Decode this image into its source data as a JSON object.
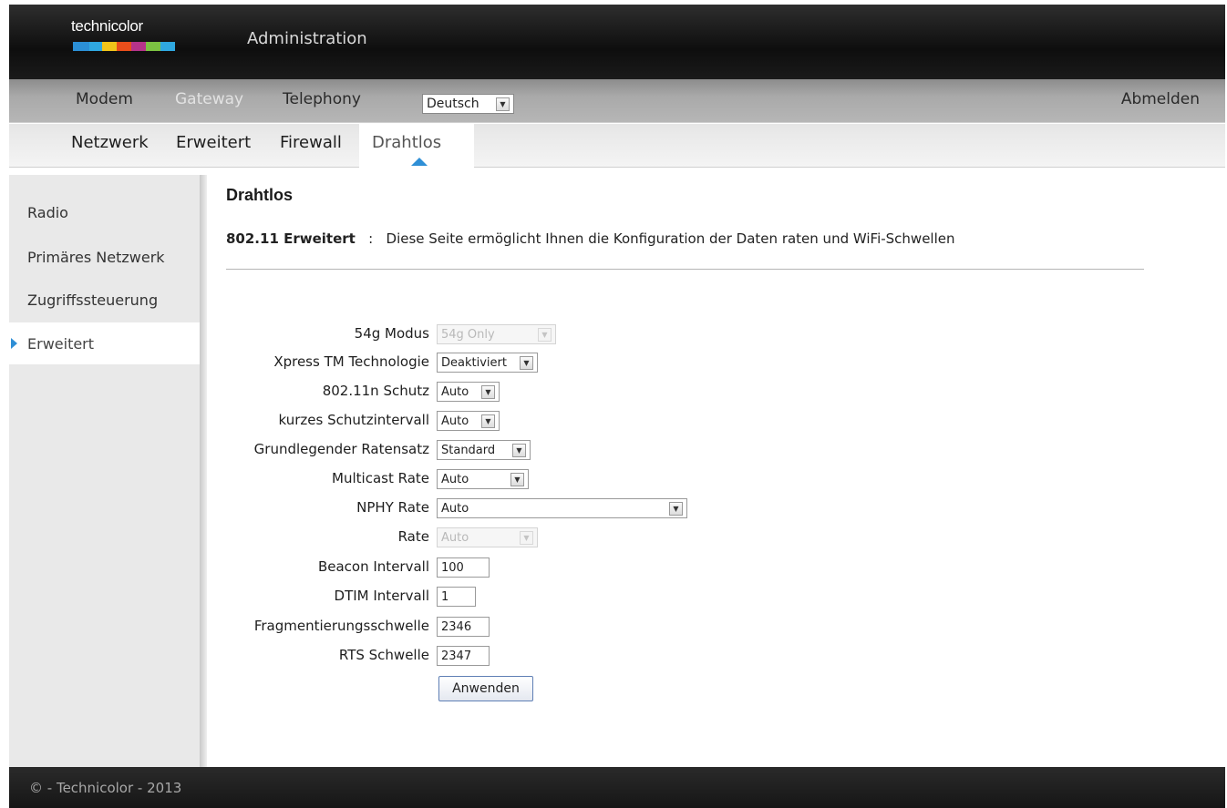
{
  "header": {
    "logo_text": "technicolor",
    "logo_colors": [
      "#2b8fd6",
      "#2fa8e0",
      "#f0c419",
      "#e94e1b",
      "#b5338a",
      "#7bc242",
      "#2fa8e0"
    ],
    "app_title": "Administration"
  },
  "main_nav": {
    "items": [
      {
        "label": "Modem",
        "active": false
      },
      {
        "label": "Gateway",
        "active": true
      },
      {
        "label": "Telephony",
        "active": false
      }
    ],
    "language": "Deutsch",
    "logout": "Abmelden"
  },
  "sub_nav": {
    "items": [
      {
        "label": "Netzwerk",
        "active": false
      },
      {
        "label": "Erweitert",
        "active": false
      },
      {
        "label": "Firewall",
        "active": false
      },
      {
        "label": "Drahtlos",
        "active": true
      }
    ]
  },
  "sidebar": {
    "items": [
      {
        "label": "Radio",
        "active": false
      },
      {
        "label": "Primäres Netzwerk",
        "active": false
      },
      {
        "label": "Zugriffssteuerung",
        "active": false
      },
      {
        "label": "Erweitert",
        "active": true
      }
    ]
  },
  "content": {
    "heading": "Drahtlos",
    "desc_title": "802.11 Erweitert",
    "desc_sep": ":",
    "desc_text": "Diese Seite ermöglicht Ihnen die Konfiguration der Daten raten und WiFi-Schwellen"
  },
  "form": {
    "mode_54g": {
      "label": "54g Modus",
      "value": "54g Only",
      "disabled": true
    },
    "xpress": {
      "label": "Xpress TM Technologie",
      "value": "Deaktiviert"
    },
    "n_protection": {
      "label": "802.11n Schutz",
      "value": "Auto"
    },
    "short_guard": {
      "label": "kurzes Schutzintervall",
      "value": "Auto"
    },
    "basic_rateset": {
      "label": "Grundlegender Ratensatz",
      "value": "Standard"
    },
    "multicast_rate": {
      "label": "Multicast Rate",
      "value": "Auto"
    },
    "nphy_rate": {
      "label": "NPHY Rate",
      "value": "Auto"
    },
    "rate": {
      "label": "Rate",
      "value": "Auto",
      "disabled": true
    },
    "beacon_interval": {
      "label": "Beacon Intervall",
      "value": "100"
    },
    "dtim_interval": {
      "label": "DTIM Intervall",
      "value": "1"
    },
    "frag_threshold": {
      "label": "Fragmentierungsschwelle",
      "value": "2346"
    },
    "rts_threshold": {
      "label": "RTS Schwelle",
      "value": "2347"
    },
    "apply_label": "Anwenden"
  },
  "footer": {
    "text": "© - Technicolor - 2013"
  }
}
